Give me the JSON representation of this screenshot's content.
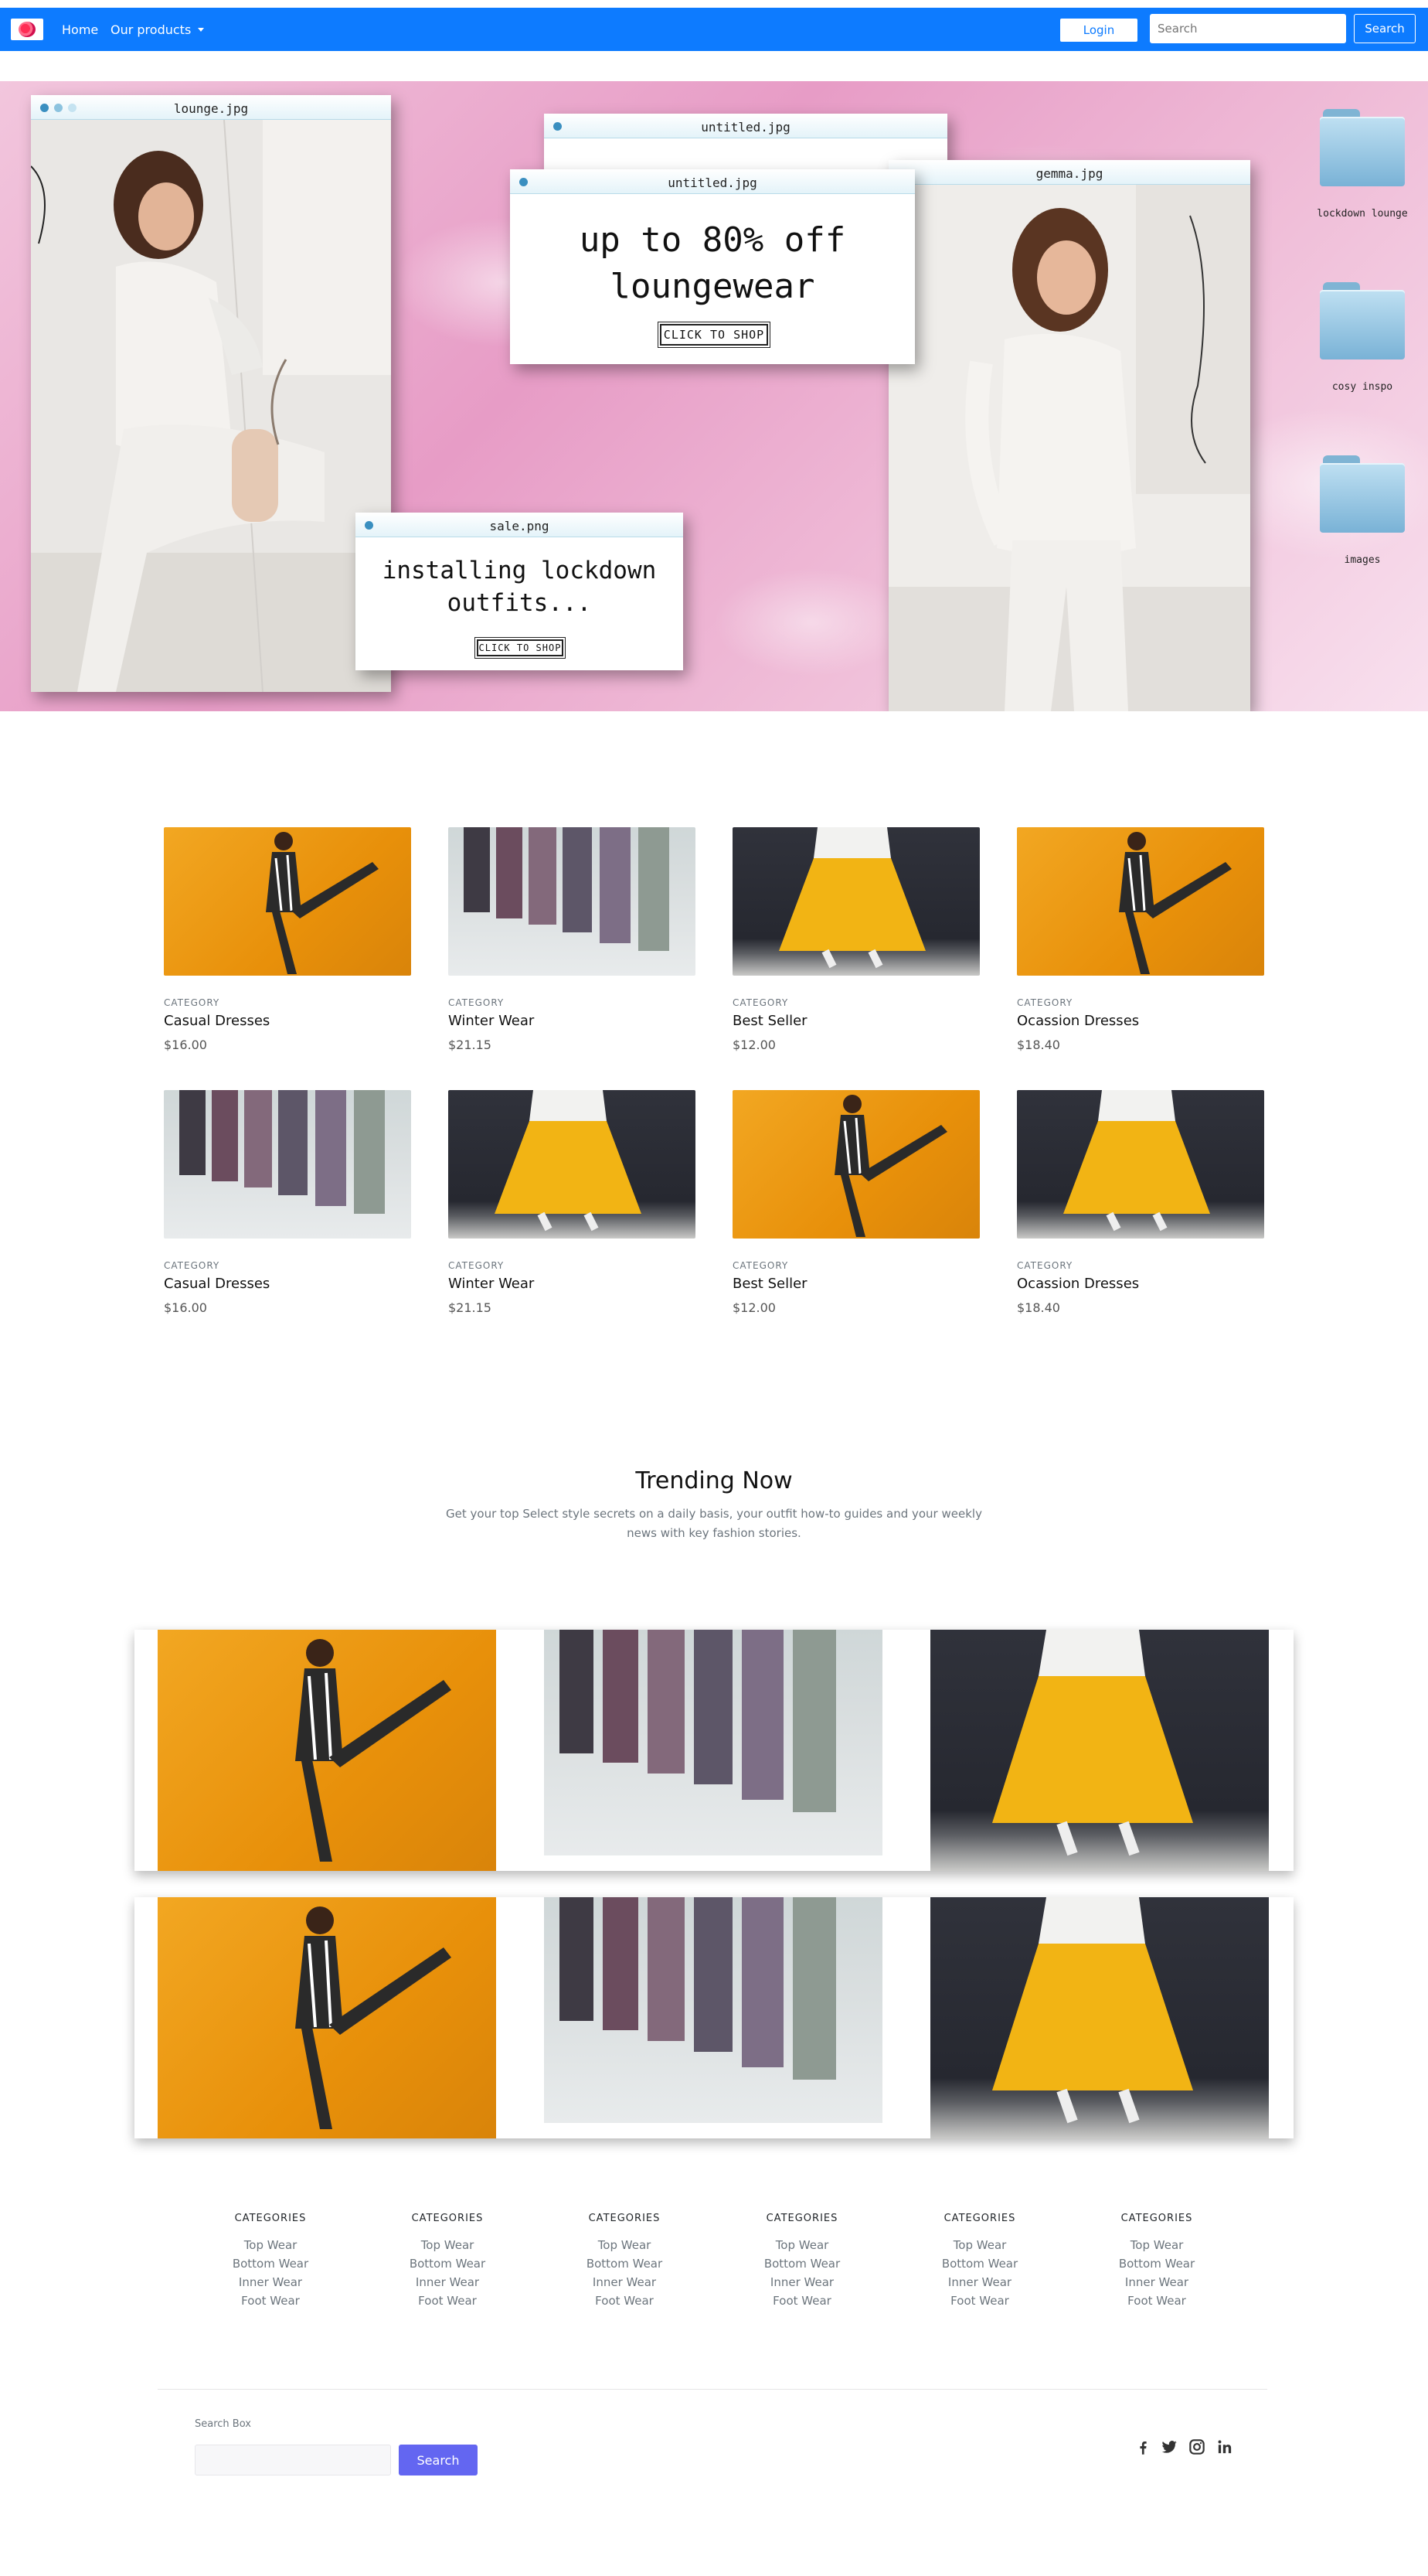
{
  "nav": {
    "home": "Home",
    "products": "Our products",
    "login": "Login",
    "search_placeholder": "Search",
    "search_button": "Search"
  },
  "hero": {
    "windows": {
      "lounge": "lounge.jpg",
      "untitled_back": "untitled.jpg",
      "untitled_front": "untitled.jpg",
      "gemma": "gemma.jpg",
      "sale": "sale.png"
    },
    "promo_headline": "up to 80% off loungewear",
    "promo_cta": "CLICK TO SHOP",
    "sale_headline": "installing lockdown outfits...",
    "sale_cta": "CLICK TO SHOP",
    "folders": [
      "lockdown lounge",
      "cosy inspo",
      "images"
    ]
  },
  "products": [
    {
      "category": "CATEGORY",
      "name": "Casual Dresses",
      "price": "$16.00",
      "image": "yellow"
    },
    {
      "category": "CATEGORY",
      "name": "Winter Wear",
      "price": "$21.15",
      "image": "runway"
    },
    {
      "category": "CATEGORY",
      "name": "Best Seller",
      "price": "$12.00",
      "image": "dark"
    },
    {
      "category": "CATEGORY",
      "name": "Ocassion Dresses",
      "price": "$18.40",
      "image": "yellow"
    },
    {
      "category": "CATEGORY",
      "name": "Casual Dresses",
      "price": "$16.00",
      "image": "runway"
    },
    {
      "category": "CATEGORY",
      "name": "Winter Wear",
      "price": "$21.15",
      "image": "dark"
    },
    {
      "category": "CATEGORY",
      "name": "Best Seller",
      "price": "$12.00",
      "image": "yellow"
    },
    {
      "category": "CATEGORY",
      "name": "Ocassion Dresses",
      "price": "$18.40",
      "image": "dark"
    }
  ],
  "trending": {
    "title": "Trending Now",
    "subtitle": "Get your top Select style secrets on a daily basis, your outfit how-to guides and your weekly news with key fashion stories."
  },
  "footer": {
    "columns": [
      {
        "heading": "CATEGORIES",
        "links": [
          "Top Wear",
          "Bottom Wear",
          "Inner Wear",
          "Foot Wear"
        ]
      },
      {
        "heading": "CATEGORIES",
        "links": [
          "Top Wear",
          "Bottom Wear",
          "Inner Wear",
          "Foot Wear"
        ]
      },
      {
        "heading": "CATEGORIES",
        "links": [
          "Top Wear",
          "Bottom Wear",
          "Inner Wear",
          "Foot Wear"
        ]
      },
      {
        "heading": "CATEGORIES",
        "links": [
          "Top Wear",
          "Bottom Wear",
          "Inner Wear",
          "Foot Wear"
        ]
      },
      {
        "heading": "CATEGORIES",
        "links": [
          "Top Wear",
          "Bottom Wear",
          "Inner Wear",
          "Foot Wear"
        ]
      },
      {
        "heading": "CATEGORIES",
        "links": [
          "Top Wear",
          "Bottom Wear",
          "Inner Wear",
          "Foot Wear"
        ]
      }
    ],
    "search_label": "Search Box",
    "search_button": "Search",
    "social_icons": [
      "facebook-icon",
      "twitter-icon",
      "instagram-icon",
      "linkedin-icon"
    ]
  },
  "colors": {
    "navbar": "#0d7bff",
    "accent": "#6366f1",
    "hero_pink": "#e79cc6"
  }
}
